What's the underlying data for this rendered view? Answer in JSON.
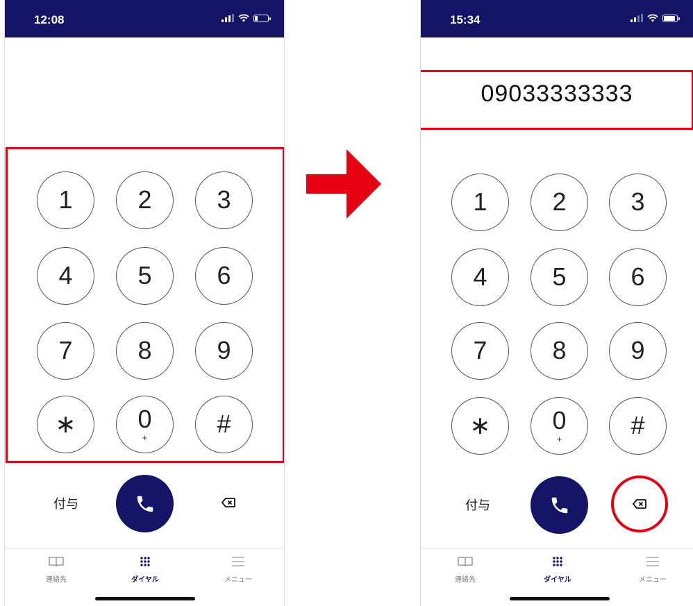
{
  "left": {
    "status": {
      "time": "12:08"
    },
    "keys": [
      {
        "d": "1",
        "sub": ""
      },
      {
        "d": "2",
        "sub": ""
      },
      {
        "d": "3",
        "sub": ""
      },
      {
        "d": "4",
        "sub": ""
      },
      {
        "d": "5",
        "sub": ""
      },
      {
        "d": "6",
        "sub": ""
      },
      {
        "d": "7",
        "sub": ""
      },
      {
        "d": "8",
        "sub": ""
      },
      {
        "d": "9",
        "sub": ""
      },
      {
        "d": "∗",
        "sub": ""
      },
      {
        "d": "0",
        "sub": "+"
      },
      {
        "d": "#",
        "sub": ""
      }
    ],
    "assign_label": "付与",
    "tabs": [
      {
        "label": "連絡先",
        "icon": "book-icon"
      },
      {
        "label": "ダイヤル",
        "icon": "keypad-icon"
      },
      {
        "label": "メニュー",
        "icon": "menu-icon"
      }
    ]
  },
  "right": {
    "status": {
      "time": "15:34"
    },
    "dialed_number": "09033333333",
    "keys": [
      {
        "d": "1",
        "sub": ""
      },
      {
        "d": "2",
        "sub": ""
      },
      {
        "d": "3",
        "sub": ""
      },
      {
        "d": "4",
        "sub": ""
      },
      {
        "d": "5",
        "sub": ""
      },
      {
        "d": "6",
        "sub": ""
      },
      {
        "d": "7",
        "sub": ""
      },
      {
        "d": "8",
        "sub": ""
      },
      {
        "d": "9",
        "sub": ""
      },
      {
        "d": "∗",
        "sub": ""
      },
      {
        "d": "0",
        "sub": "+"
      },
      {
        "d": "#",
        "sub": ""
      }
    ],
    "assign_label": "付与",
    "tabs": [
      {
        "label": "連絡先",
        "icon": "book-icon"
      },
      {
        "label": "ダイヤル",
        "icon": "keypad-icon"
      },
      {
        "label": "メニュー",
        "icon": "menu-icon"
      }
    ]
  },
  "colors": {
    "navy": "#141566",
    "highlight": "#e60012",
    "active_tab": "ダイヤル"
  }
}
